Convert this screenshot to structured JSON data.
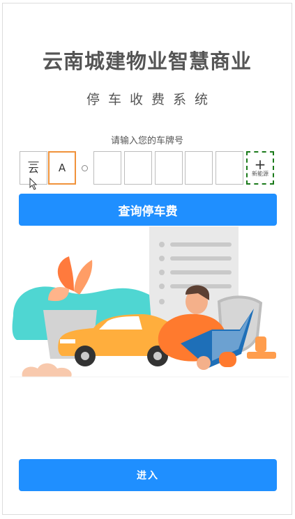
{
  "header": {
    "title": "云南城建物业智慧商业",
    "subtitle": "停车收费系统"
  },
  "plate_input": {
    "prompt": "请输入您的车牌号",
    "boxes": [
      "云",
      "A",
      "",
      "",
      "",
      "",
      ""
    ],
    "new_energy_plus": "+",
    "new_energy_label": "新能源"
  },
  "actions": {
    "query_label": "查询停车费",
    "enter_label": "进入"
  },
  "colors": {
    "primary": "#1f8fff",
    "active_border": "#f0923a",
    "ev_border": "#1a7a1a"
  }
}
